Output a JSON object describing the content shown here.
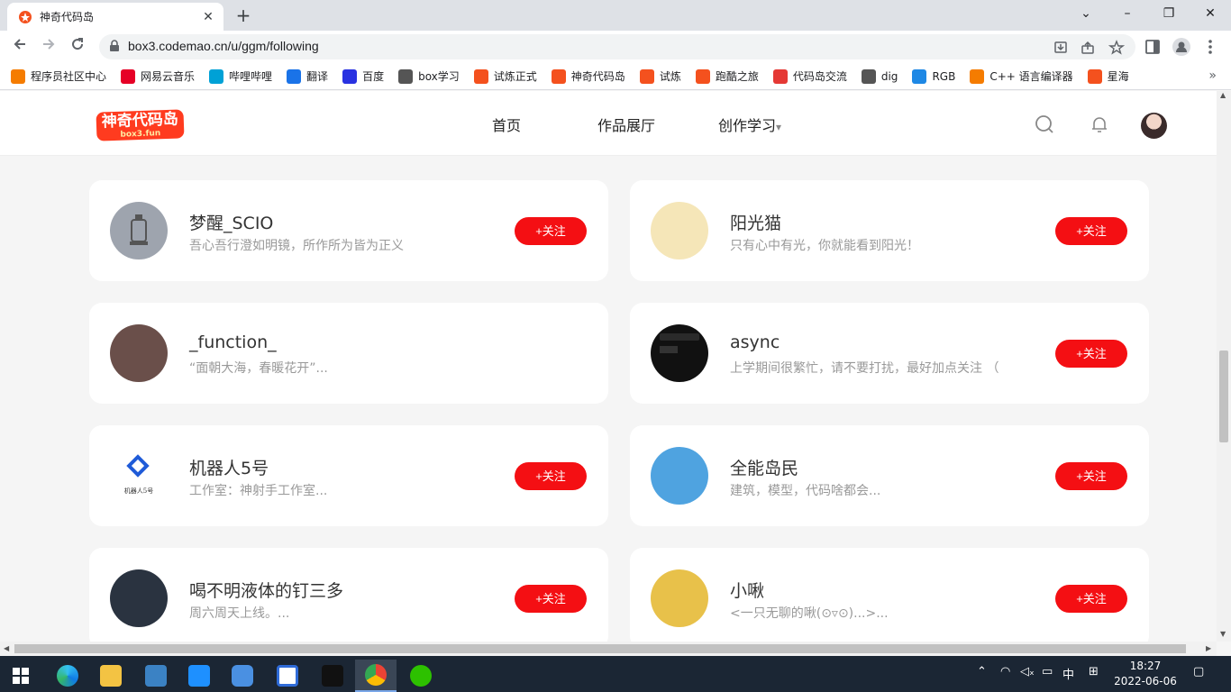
{
  "browser": {
    "tab_title": "神奇代码岛",
    "tab_close": "✕",
    "new_tab": "+",
    "url": "box3.codemao.cn/u/ggm/following",
    "window_controls": {
      "minimize": "–",
      "maximize": "❐",
      "close": "✕"
    },
    "chevron": "⌄"
  },
  "bookmarks": [
    {
      "label": "程序员社区中心",
      "icon": "codemao-icon",
      "color": "#f57c00"
    },
    {
      "label": "网易云音乐",
      "icon": "netease-music-icon",
      "color": "#e60026"
    },
    {
      "label": "哔哩哔哩",
      "icon": "bilibili-icon",
      "color": "#00a1d6"
    },
    {
      "label": "翻译",
      "icon": "translate-icon",
      "color": "#1a73e8"
    },
    {
      "label": "百度",
      "icon": "baidu-icon",
      "color": "#2932e1"
    },
    {
      "label": "box学习",
      "icon": "book-icon",
      "color": "#555555"
    },
    {
      "label": "试炼正式",
      "icon": "box3-icon",
      "color": "#f4511e"
    },
    {
      "label": "神奇代码岛",
      "icon": "box3-icon",
      "color": "#f4511e"
    },
    {
      "label": "试炼",
      "icon": "box3-icon",
      "color": "#f4511e"
    },
    {
      "label": "跑酷之旅",
      "icon": "box3-icon",
      "color": "#f4511e"
    },
    {
      "label": "代码岛交流",
      "icon": "forum-icon",
      "color": "#e53935"
    },
    {
      "label": "dig",
      "icon": "gear-icon",
      "color": "#555555"
    },
    {
      "label": "RGB",
      "icon": "edge-icon",
      "color": "#1e88e5"
    },
    {
      "label": "C++ 语言编译器",
      "icon": "compiler-icon",
      "color": "#f57c00"
    },
    {
      "label": "星海",
      "icon": "box3-icon",
      "color": "#f4511e"
    }
  ],
  "bookmarks_more": "»",
  "site": {
    "logo_text": "神奇代码岛",
    "logo_sub": "box3.fun",
    "nav": [
      "首页",
      "作品展厅",
      "创作学习"
    ],
    "nav_dropdown_arrow": "▾"
  },
  "follow_label": "+关注",
  "following": [
    {
      "name": "梦醒_SCIO",
      "desc": "吾心吾行澄如明镜，所作所为皆为正义",
      "follow": true,
      "avatar_color": "#9ea4ae"
    },
    {
      "name": "阳光猫",
      "desc": "只有心中有光，你就能看到阳光！",
      "follow": true,
      "avatar_color": "#f5e6b8"
    },
    {
      "name": "_function_",
      "desc": "“面朝大海，春暖花开”...",
      "follow": false,
      "avatar_color": "#6a4f4a"
    },
    {
      "name": "async",
      "desc": "上学期间很繁忙，请不要打扰，最好加点关注 （",
      "follow": true,
      "avatar_color": "#111111"
    },
    {
      "name": "机器人5号",
      "desc": "工作室：神射手工作室...",
      "follow": true,
      "avatar_color": "#ffffff"
    },
    {
      "name": "全能岛民",
      "desc": "建筑，模型，代码啥都会...",
      "follow": true,
      "avatar_color": "#4fa3e0"
    },
    {
      "name": "喝不明液体的钉三多",
      "desc": "周六周天上线。...",
      "follow": true,
      "avatar_color": "#2a3340"
    },
    {
      "name": "小啾",
      "desc": "<一只无聊的啾(⊙▿⊙)...>...",
      "follow": true,
      "avatar_color": "#e8c14a"
    }
  ],
  "robot_avatar_caption": "机器人5号",
  "taskbar": {
    "ime": "中",
    "time": "18:27",
    "date": "2022-06-06"
  }
}
